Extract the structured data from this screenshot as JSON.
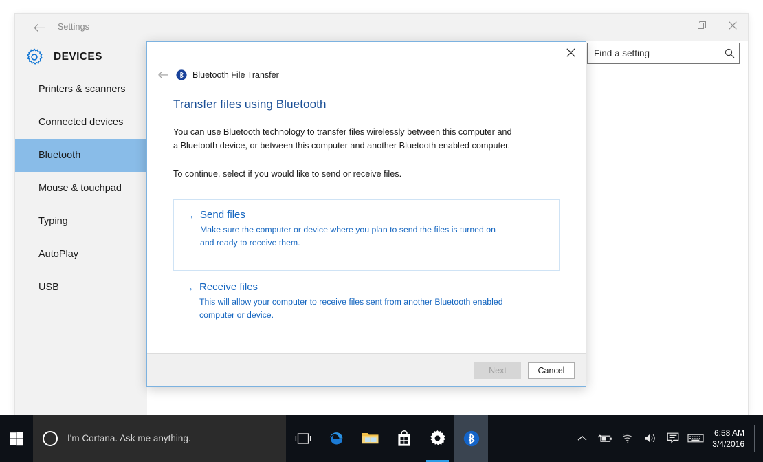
{
  "window": {
    "back_label": "back-arrow",
    "title": "Settings",
    "page_title": "DEVICES",
    "gear_icon": "gear-icon",
    "controls": {
      "minimize": "minimize-icon",
      "maximize": "restore-icon",
      "close": "close-icon"
    }
  },
  "search": {
    "value": "Find a setting",
    "icon": "search-icon"
  },
  "sidebar": {
    "items": [
      {
        "label": "Printers & scanners",
        "selected": false
      },
      {
        "label": "Connected devices",
        "selected": false
      },
      {
        "label": "Bluetooth",
        "selected": true
      },
      {
        "label": "Mouse & touchpad",
        "selected": false
      },
      {
        "label": "Typing",
        "selected": false
      },
      {
        "label": "AutoPlay",
        "selected": false
      },
      {
        "label": "USB",
        "selected": false
      }
    ],
    "selected_color": "#89bce8"
  },
  "dialog": {
    "close_label": "close-icon",
    "back_label": "back-arrow-icon",
    "bluetooth_icon": "bluetooth-icon",
    "breadcrumb": "Bluetooth File Transfer",
    "heading": "Transfer files using Bluetooth",
    "paragraph1": "You can use Bluetooth technology to transfer files wirelessly between this computer and a Bluetooth device, or between this computer and another Bluetooth enabled computer.",
    "paragraph2": "To continue, select if you would like to send or receive files.",
    "choices": [
      {
        "arrow": "→",
        "title": "Send files",
        "description": "Make sure the computer or device where you plan to send the files is turned on and ready to receive them.",
        "boxed": true
      },
      {
        "arrow": "→",
        "title": "Receive files",
        "description": "This will allow your computer to receive files sent from another Bluetooth enabled computer or device.",
        "boxed": false
      }
    ],
    "buttons": {
      "next": "Next",
      "next_disabled": true,
      "cancel": "Cancel"
    },
    "link_color": "#1566c0",
    "heading_color": "#1a4f96",
    "border_color": "#7cb2e0"
  },
  "taskbar": {
    "start_icon": "windows-start-icon",
    "cortana": {
      "ring_icon": "cortana-circle-icon",
      "placeholder": "I'm Cortana. Ask me anything."
    },
    "apps": [
      {
        "name": "task-view-icon",
        "state": "idle"
      },
      {
        "name": "edge-icon",
        "state": "idle"
      },
      {
        "name": "file-explorer-icon",
        "state": "idle"
      },
      {
        "name": "store-icon",
        "state": "idle"
      },
      {
        "name": "settings-icon",
        "state": "active"
      },
      {
        "name": "bluetooth-icon",
        "state": "running"
      }
    ],
    "tray": [
      "show-hidden-icons-chevron",
      "battery-icon",
      "wifi-icon",
      "volume-icon",
      "action-center-icon",
      "keyboard-icon"
    ],
    "clock": {
      "time": "6:58 AM",
      "date": "3/4/2016"
    }
  }
}
